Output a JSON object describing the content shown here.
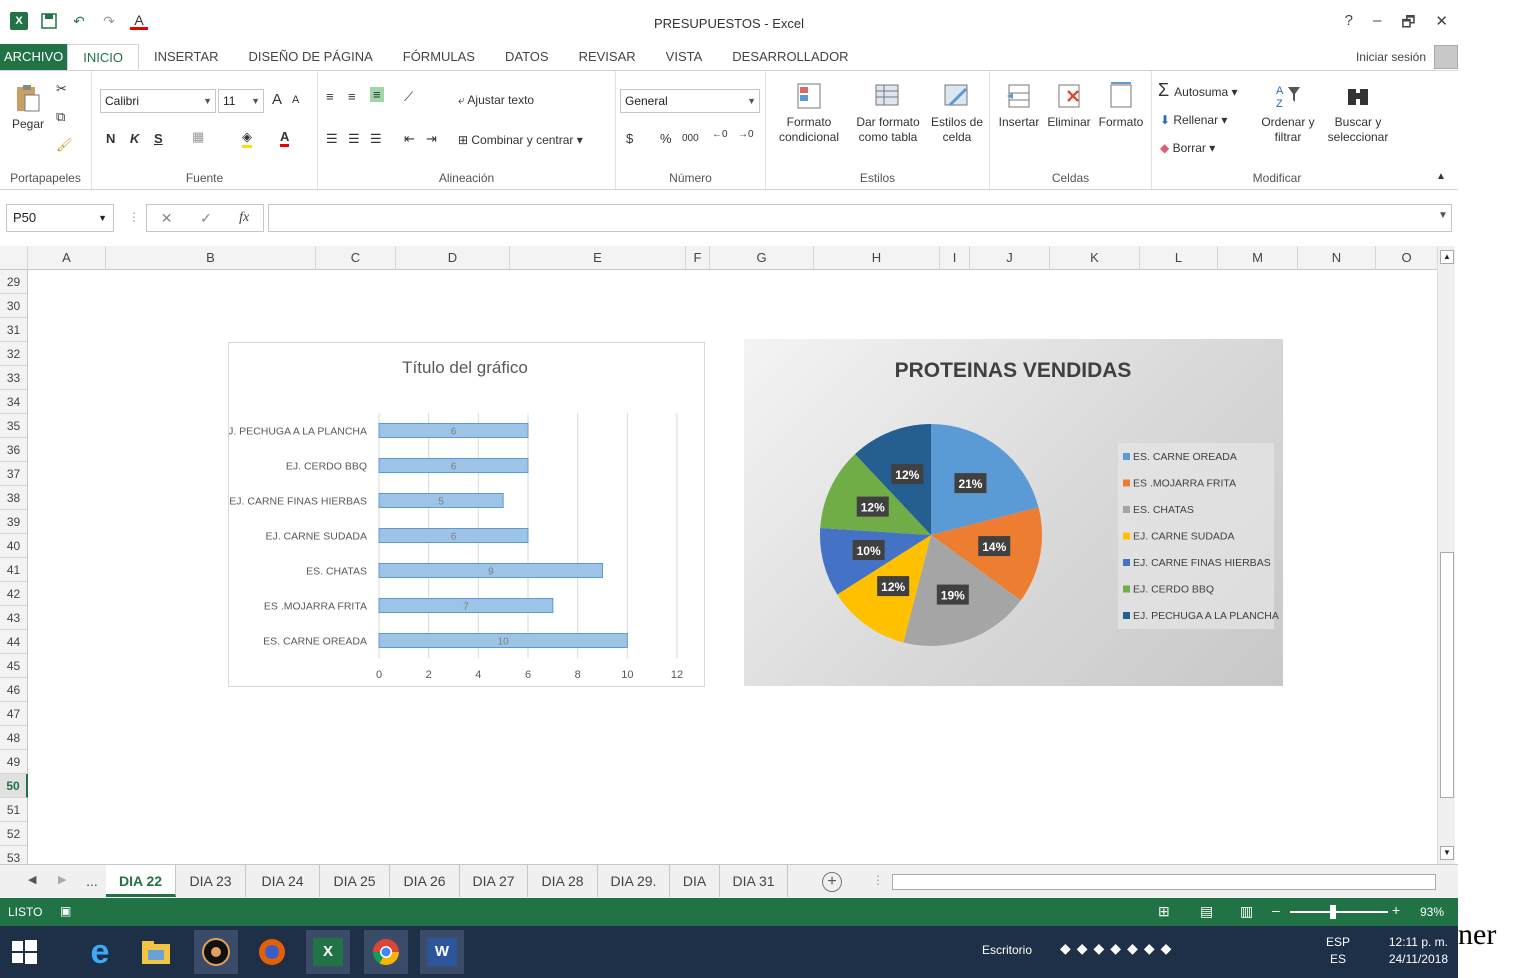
{
  "window": {
    "title": "PRESUPUESTOS - Excel",
    "help": "?",
    "minimize": "–",
    "restore": "🗗",
    "close": "✕"
  },
  "qat": {
    "logo": "X",
    "save_icon": "floppy-icon",
    "undo": "↶",
    "redo": "↷",
    "font_color": "A"
  },
  "ribbon_tabs": [
    "ARCHIVO",
    "INICIO",
    "INSERTAR",
    "DISEÑO DE PÁGINA",
    "FÓRMULAS",
    "DATOS",
    "REVISAR",
    "VISTA",
    "DESARROLLADOR"
  ],
  "active_tab": "INICIO",
  "signin": "Iniciar sesión",
  "ribbon": {
    "clipboard": {
      "paste": "Pegar",
      "label": "Portapapeles"
    },
    "font": {
      "name": "Calibri",
      "size": "11",
      "bold": "N",
      "italic": "K",
      "underline": "S",
      "label": "Fuente",
      "grow": "A",
      "shrink": "A"
    },
    "alignment": {
      "wrap": "Ajustar texto",
      "merge": "Combinar y centrar",
      "label": "Alineación"
    },
    "number": {
      "format": "General",
      "currency": "$",
      "percent": "%",
      "thousands": "000",
      "label": "Número"
    },
    "styles": {
      "conditional": "Formato condicional",
      "table": "Dar formato como tabla",
      "cell": "Estilos de celda",
      "label": "Estilos"
    },
    "cells": {
      "insert": "Insertar",
      "delete": "Eliminar",
      "format": "Formato",
      "label": "Celdas"
    },
    "editing": {
      "autosum": "Autosuma",
      "fill": "Rellenar",
      "clear": "Borrar",
      "sort": "Ordenar y filtrar",
      "find": "Buscar y seleccionar",
      "label": "Modificar"
    }
  },
  "formula_bar": {
    "name_box": "P50",
    "cancel": "✕",
    "enter": "✓",
    "fx": "fx",
    "value": ""
  },
  "columns": [
    "A",
    "B",
    "C",
    "D",
    "E",
    "F",
    "G",
    "H",
    "I",
    "J",
    "K",
    "L",
    "M",
    "N",
    "O"
  ],
  "rows": [
    "29",
    "30",
    "31",
    "32",
    "33",
    "34",
    "35",
    "36",
    "37",
    "38",
    "39",
    "40",
    "41",
    "42",
    "43",
    "44",
    "45",
    "46",
    "47",
    "48",
    "49",
    "50",
    "51",
    "52",
    "53"
  ],
  "selected_row": "50",
  "sheet_tabs": [
    "...",
    "DIA 22",
    "DIA 23",
    "DIA  24",
    "DIA 25",
    "DIA 26",
    "DIA 27",
    "DIA 28",
    "DIA 29.",
    "DIA",
    "DIA 31"
  ],
  "active_sheet": "DIA 22",
  "status": {
    "text": "LISTO",
    "zoom": "93%",
    "zoom_level": 0.93
  },
  "taskbar": {
    "desktop": "Escritorio",
    "lang1": "ESP",
    "lang2": "ES",
    "time": "12:11 p. m.",
    "date": "24/11/2018",
    "apps": [
      "windows-start-icon",
      "internet-explorer-icon",
      "file-explorer-icon",
      "speaker-app-icon",
      "firefox-icon",
      "excel-icon",
      "chrome-icon",
      "word-icon"
    ]
  },
  "overflow_text": "ner",
  "chart_data": [
    {
      "type": "bar",
      "orientation": "horizontal",
      "title": "Título del gráfico",
      "categories": [
        "ES. CARNE OREADA",
        "ES .MOJARRA FRITA",
        "ES. CHATAS",
        "EJ. CARNE SUDADA",
        "EJ. CARNE FINAS HIERBAS",
        "EJ. CERDO BBQ",
        "EJ. PECHUGA A LA PLANCHA"
      ],
      "values": [
        10,
        7,
        9,
        6,
        5,
        6,
        6
      ],
      "data_labels": [
        "10",
        "7",
        "9",
        "6",
        "5",
        "6",
        "6"
      ],
      "xlim": [
        0,
        12
      ],
      "xticks": [
        "0",
        "2",
        "4",
        "6",
        "8",
        "10",
        "12"
      ],
      "grid": true,
      "color": "#9dc3e6"
    },
    {
      "type": "pie",
      "title": "PROTEINAS VENDIDAS",
      "categories": [
        "ES. CARNE OREADA",
        "ES .MOJARRA FRITA",
        "ES. CHATAS",
        "EJ. CARNE SUDADA",
        "EJ. CARNE FINAS HIERBAS",
        "EJ. CERDO BBQ",
        "EJ. PECHUGA A LA PLANCHA"
      ],
      "values": [
        21,
        14,
        19,
        12,
        10,
        12,
        12
      ],
      "labels": [
        "21%",
        "14%",
        "19%",
        "12%",
        "10%",
        "12%",
        "12%"
      ],
      "colors": [
        "#5b9bd5",
        "#ed7d31",
        "#a5a5a5",
        "#ffc000",
        "#4472c4",
        "#70ad47",
        "#255e91"
      ],
      "legend": "right"
    }
  ]
}
